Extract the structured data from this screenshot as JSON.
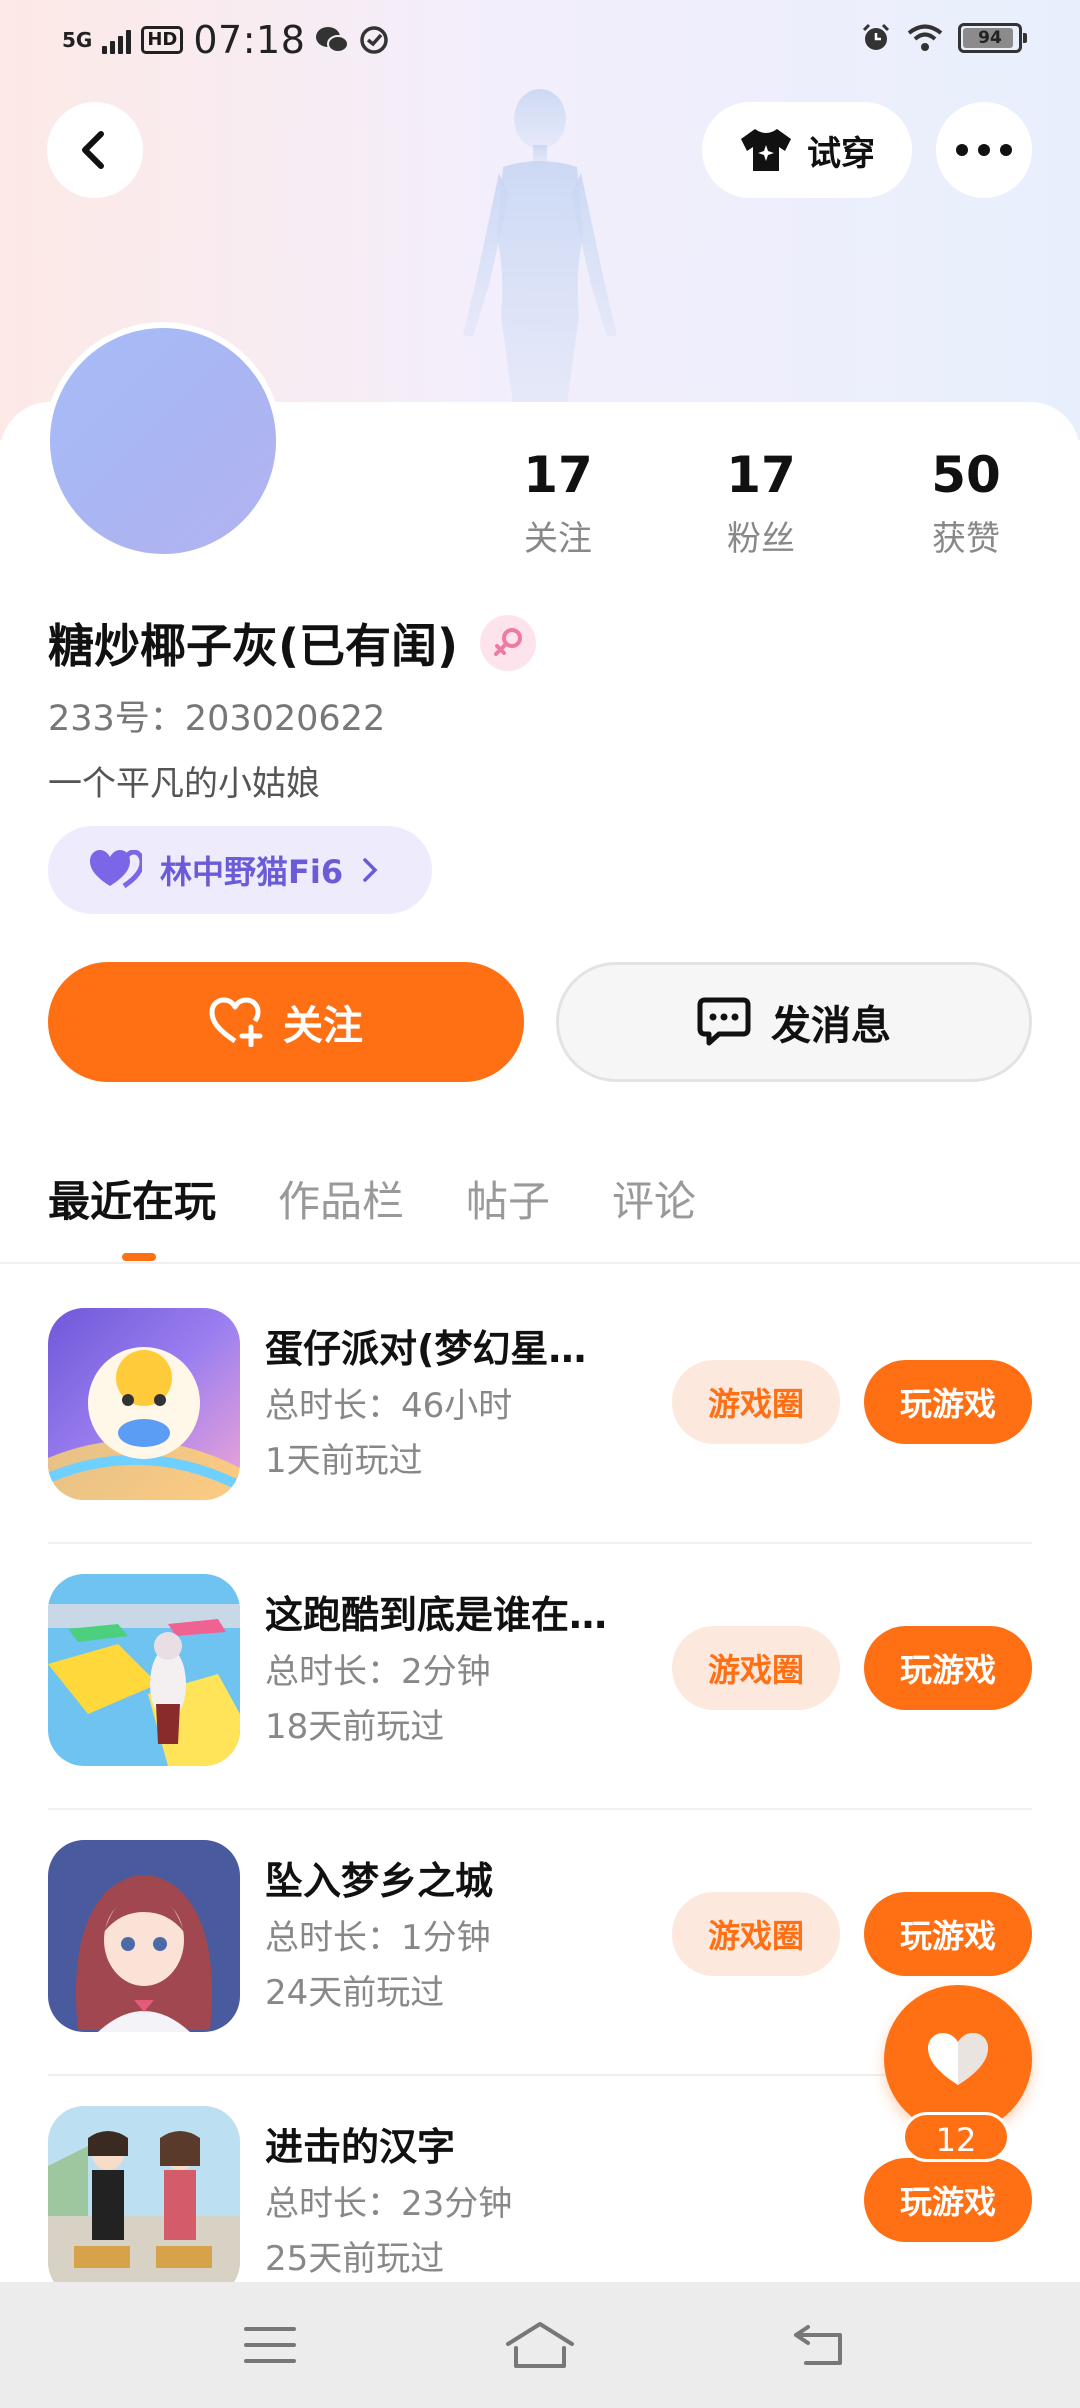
{
  "status_bar": {
    "network": "5G",
    "hd": "HD",
    "time": "07:18",
    "battery": "94"
  },
  "header": {
    "tryon_label": "试穿"
  },
  "stats": [
    {
      "value": "17",
      "label": "关注"
    },
    {
      "value": "17",
      "label": "粉丝"
    },
    {
      "value": "50",
      "label": "获赞"
    }
  ],
  "profile": {
    "nickname": "糖炒椰子灰(已有闺)",
    "uid": "233号：203020622",
    "bio": "一个平凡的小姑娘",
    "cp_name": "林中野猫Fi6"
  },
  "actions": {
    "follow_label": "关注",
    "message_label": "发消息"
  },
  "tabs": [
    "最近在玩",
    "作品栏",
    "帖子",
    "评论"
  ],
  "games": [
    {
      "title": "蛋仔派对(梦幻星…",
      "duration": "总时长：46小时",
      "last_played": "1天前玩过",
      "circle_label": "游戏圈",
      "play_label": "玩游戏"
    },
    {
      "title": "这跑酷到底是谁在…",
      "duration": "总时长：2分钟",
      "last_played": "18天前玩过",
      "circle_label": "游戏圈",
      "play_label": "玩游戏"
    },
    {
      "title": "坠入梦乡之城",
      "duration": "总时长：1分钟",
      "last_played": "24天前玩过",
      "circle_label": "游戏圈",
      "play_label": "玩游戏"
    },
    {
      "title": "进击的汉字",
      "duration": "总时长：23分钟",
      "last_played": "25天前玩过",
      "play_label": "玩游戏"
    }
  ],
  "like_fab": {
    "count": "12"
  },
  "colors": {
    "accent": "#ff7014",
    "accent_soft": "#fde8dd",
    "chip_bg": "#eeebfd",
    "chip_text": "#6a5bd6"
  },
  "icons": {
    "back": "chevron-left-icon",
    "tryon": "tshirt-icon",
    "more": "more-dots-icon",
    "gender": "female-icon",
    "cp": "heart-pair-icon",
    "follow": "heart-plus-icon",
    "message": "chat-bubble-icon",
    "like": "heart-icon",
    "nav": [
      "menu-icon",
      "home-icon",
      "back-nav-icon"
    ]
  }
}
